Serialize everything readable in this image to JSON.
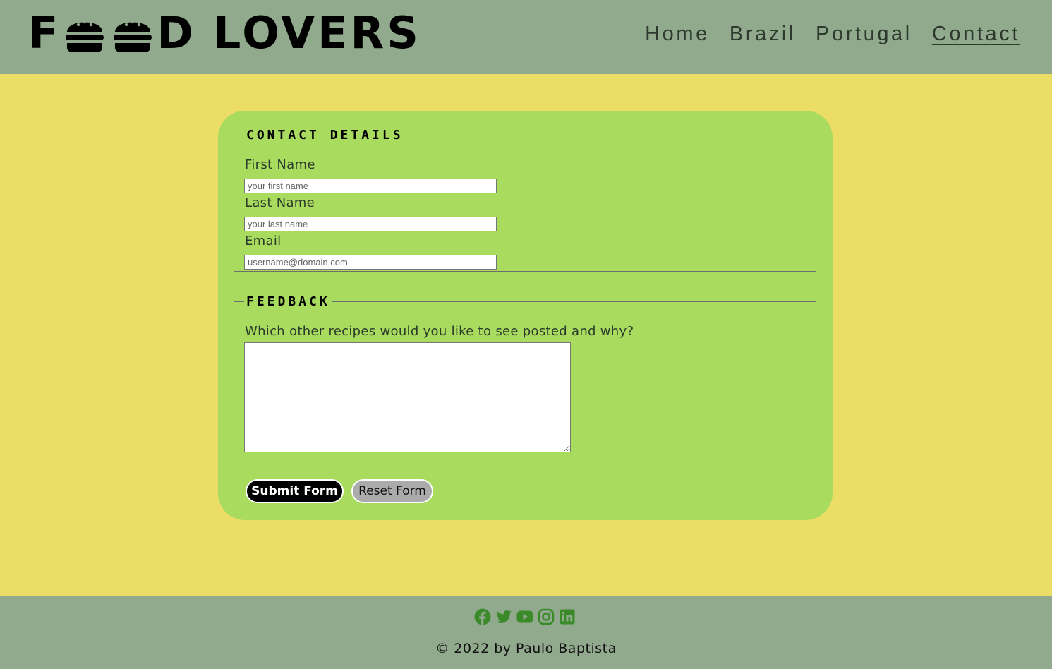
{
  "header": {
    "logo": {
      "first_letter": "F",
      "last_letter": "D",
      "second_word": "LOVERS",
      "burger_icons": [
        "burger-icon",
        "burger-icon"
      ]
    },
    "nav": [
      {
        "label": "Home",
        "active": false
      },
      {
        "label": "Brazil",
        "active": false
      },
      {
        "label": "Portugal",
        "active": false
      },
      {
        "label": "Contact",
        "active": true
      }
    ]
  },
  "form": {
    "contact": {
      "legend": "CONTACT DETAILS",
      "first_name_label": "First Name",
      "first_name_placeholder": "your first name",
      "last_name_label": "Last Name",
      "last_name_placeholder": "your last name",
      "email_label": "Email",
      "email_placeholder": "username@domain.com"
    },
    "feedback": {
      "legend": "FEEDBACK",
      "question": "Which other recipes would you like to see posted and why?"
    },
    "submit_label": "Submit Form",
    "reset_label": "Reset Form"
  },
  "footer": {
    "socials": [
      "facebook-icon",
      "twitter-icon",
      "youtube-icon",
      "instagram-icon",
      "linkedin-icon"
    ],
    "copyright": "© 2022 by Paulo Baptista"
  },
  "colors": {
    "background": "#ecdd66",
    "header_footer": "#91aa8d",
    "card": "#a9db5f",
    "social_icons": "#3a8a2a"
  }
}
